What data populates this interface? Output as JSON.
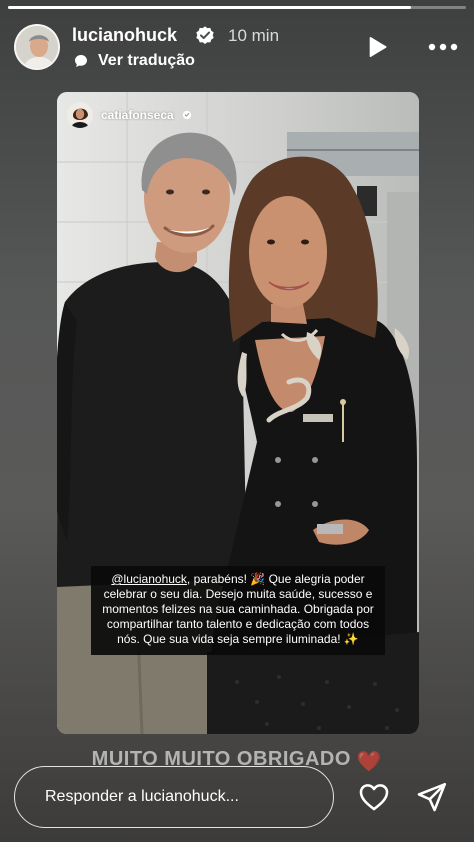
{
  "story": {
    "username": "lucianohuck",
    "time": "10 min",
    "translate_label": "Ver tradução",
    "progress": 0.88,
    "icons": {
      "verified": "verified-badge-icon",
      "translate": "translate-icon",
      "play": "play-icon",
      "more": "more-options-icon",
      "like": "heart-icon",
      "share": "send-icon"
    }
  },
  "shared_post": {
    "username": "catiafonseca",
    "caption_mention": "@lucianohuck",
    "caption_rest": ", parabéns! 🎉 Que alegria poder celebrar o seu dia. Desejo muita saúde, sucesso e momentos felizes na sua caminhada. Obrigada por compartilhar tanto talento e dedicação com todos nós. Que sua vida seja sempre iluminada! ✨"
  },
  "overlay_text": "MUITO MUITO OBRIGADO",
  "overlay_emoji": "❤️",
  "reply": {
    "placeholder": "Responder a lucianohuck..."
  },
  "colors": {
    "heart_emoji": "#d0232e",
    "verified": "#ffffff",
    "background_top": "#3e3f3f",
    "background_bottom": "#3c3b39"
  }
}
